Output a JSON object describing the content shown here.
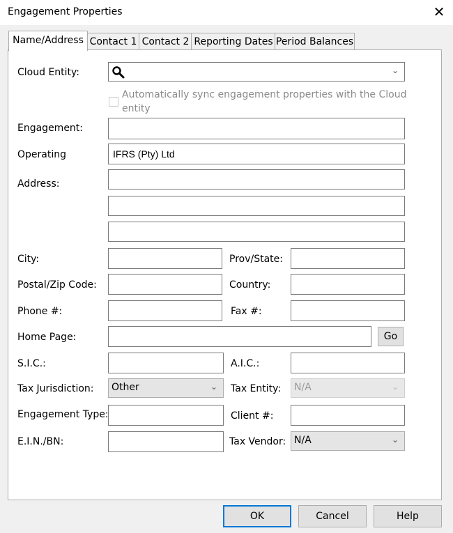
{
  "window": {
    "title": "Engagement Properties",
    "close_glyph": "✕"
  },
  "tabs": [
    {
      "label": "Name/Address",
      "active": true
    },
    {
      "label": "Contact 1"
    },
    {
      "label": "Contact 2"
    },
    {
      "label": "Reporting Dates"
    },
    {
      "label": "Period Balances"
    }
  ],
  "form": {
    "cloud_entity_label": "Cloud Entity:",
    "cloud_entity_value": "",
    "sync_label_line1": "Automatically sync engagement properties with the Cloud",
    "sync_label_line2": "entity",
    "sync_checked": false,
    "engagement_label": "Engagement:",
    "engagement_value": "",
    "operating_label": "Operating",
    "operating_value": "IFRS (Pty) Ltd",
    "address_label": "Address:",
    "address_line1": "",
    "address_line2": "",
    "address_line3": "",
    "city_label": "City:",
    "city_value": "",
    "prov_label": "Prov/State:",
    "prov_value": "",
    "postal_label": "Postal/Zip Code:",
    "postal_value": "",
    "country_label": "Country:",
    "country_value": "",
    "phone_label": "Phone #:",
    "phone_value": "",
    "fax_label": "Fax #:",
    "fax_value": "",
    "homepage_label": "Home Page:",
    "homepage_value": "",
    "go_label": "Go",
    "sic_label": "S.I.C.:",
    "sic_value": "",
    "aic_label": "A.I.C.:",
    "aic_value": "",
    "taxjur_label": "Tax Jurisdiction:",
    "taxjur_value": "Other",
    "taxentity_label": "Tax Entity:",
    "taxentity_value": "N/A",
    "engtype_label": "Engagement Type:",
    "engtype_value": "",
    "client_label": "Client #:",
    "client_value": "",
    "ein_label": "E.I.N./BN:",
    "ein_value": "",
    "taxvendor_label": "Tax Vendor:",
    "taxvendor_value": "N/A"
  },
  "buttons": {
    "ok": "OK",
    "cancel": "Cancel",
    "help": "Help"
  },
  "icons": {
    "search": "search-icon",
    "chevron": "chevron-down-icon",
    "close": "close-icon"
  },
  "colors": {
    "default_button_border": "#0078d7"
  }
}
